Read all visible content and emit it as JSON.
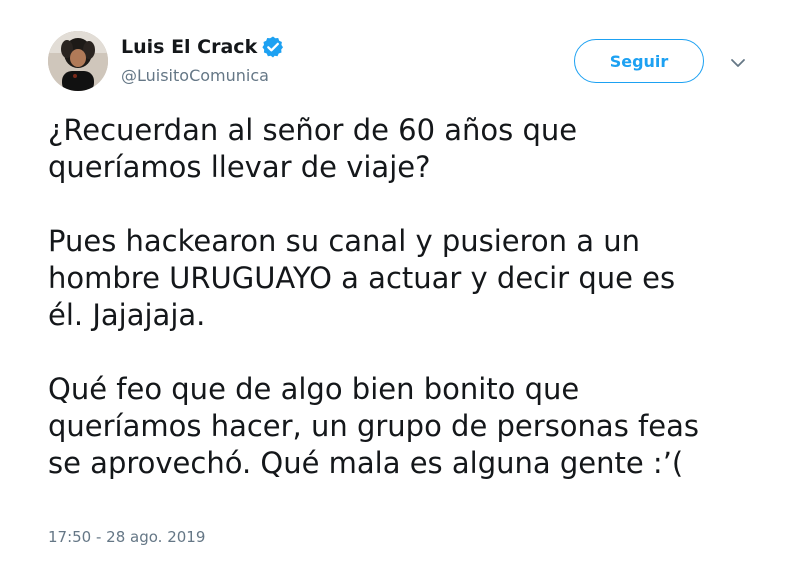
{
  "author": {
    "display_name": "Luis El Crack",
    "handle": "@LuisitoComunica",
    "verified": true,
    "avatar_icon": "profile-photo"
  },
  "actions": {
    "follow_label": "Seguir",
    "more_icon": "chevron-down-icon"
  },
  "tweet": {
    "paragraphs": [
      "¿Recuerdan al señor de 60 años que\nqueríamos llevar de viaje?",
      "Pues hackearon su canal y pusieron a un\nhombre URUGUAYO a actuar y decir que es\nél. Jajajaja.",
      "Qué feo que de algo bien bonito que\nqueríamos hacer, un grupo de personas feas\nse aprovechó. Qué mala es alguna gente :’("
    ],
    "timestamp": "17:50 - 28 ago. 2019"
  },
  "colors": {
    "accent": "#1da1f2",
    "text": "#14171a",
    "muted": "#657786"
  }
}
